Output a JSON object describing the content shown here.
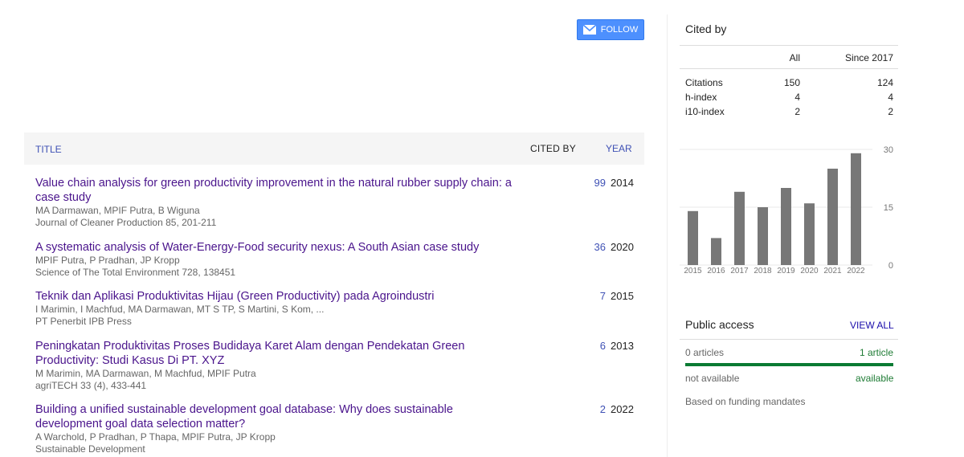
{
  "follow": {
    "label": "FOLLOW"
  },
  "table": {
    "headers": {
      "title": "TITLE",
      "cited_by": "CITED BY",
      "year": "YEAR"
    },
    "rows": [
      {
        "title": "Value chain analysis for green productivity improvement in the natural rubber supply chain: a case study",
        "authors": "MA Darmawan, MPIF Putra, B Wiguna",
        "venue": "Journal of Cleaner Production 85, 201-211",
        "cited_by": "99",
        "year": "2014"
      },
      {
        "title": "A systematic analysis of Water-Energy-Food security nexus: A South Asian case study",
        "authors": "MPIF Putra, P Pradhan, JP Kropp",
        "venue": "Science of The Total Environment 728, 138451",
        "cited_by": "36",
        "year": "2020"
      },
      {
        "title": "Teknik dan Aplikasi Produktivitas Hijau (Green Productivity) pada Agroindustri",
        "authors": "I Marimin, I Machfud, MA Darmawan, MT S TP, S Martini, S Kom, ...",
        "venue": "PT Penerbit IPB Press",
        "cited_by": "7",
        "year": "2015"
      },
      {
        "title": "Peningkatan Produktivitas Proses Budidaya Karet Alam dengan Pendekatan Green Productivity: Studi Kasus Di PT. XYZ",
        "authors": "M Marimin, MA Darmawan, M Machfud, MPIF Putra",
        "venue": "agriTECH 33 (4), 433-441",
        "cited_by": "6",
        "year": "2013"
      },
      {
        "title": "Building a unified sustainable development goal database: Why does sustainable development goal data selection matter?",
        "authors": "A Warchold, P Pradhan, P Thapa, MPIF Putra, JP Kropp",
        "venue": "Sustainable Development",
        "cited_by": "2",
        "year": "2022"
      }
    ]
  },
  "cited_by": {
    "title": "Cited by",
    "col_all": "All",
    "col_since": "Since 2017",
    "metrics": [
      {
        "label": "Citations",
        "all": "150",
        "since": "124"
      },
      {
        "label": "h-index",
        "all": "4",
        "since": "4"
      },
      {
        "label": "i10-index",
        "all": "2",
        "since": "2"
      }
    ]
  },
  "chart_data": {
    "type": "bar",
    "categories": [
      "2015",
      "2016",
      "2017",
      "2018",
      "2019",
      "2020",
      "2021",
      "2022"
    ],
    "values": [
      14,
      7,
      19,
      15,
      20,
      16,
      25,
      29
    ],
    "ylim": [
      0,
      30
    ],
    "yticks": [
      "0",
      "15",
      "30"
    ],
    "bar_color": "#777777",
    "grid": true
  },
  "public_access": {
    "title": "Public access",
    "view_all": "VIEW ALL",
    "not_available_count": "0 articles",
    "available_count": "1 article",
    "not_available_label": "not available",
    "available_label": "available",
    "note": "Based on funding mandates"
  },
  "colors": {
    "accent": "#4d90fe",
    "link": "#1a0dab",
    "available": "#0a7b33"
  }
}
